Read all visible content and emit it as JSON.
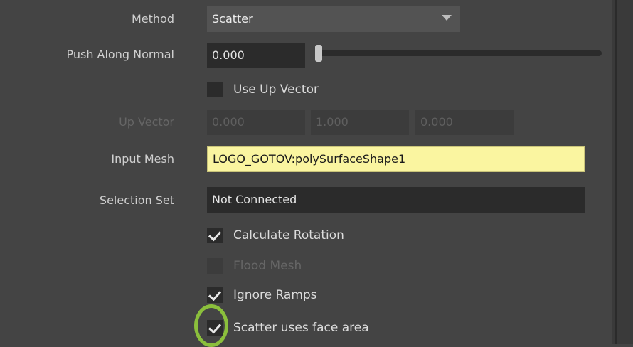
{
  "method": {
    "label": "Method",
    "value": "Scatter"
  },
  "push_along_normal": {
    "label": "Push Along Normal",
    "value": "0.000",
    "slider_fraction": 0.0
  },
  "use_up_vector": {
    "label": "Use Up Vector",
    "checked": false
  },
  "up_vector": {
    "label": "Up Vector",
    "x": "0.000",
    "y": "1.000",
    "z": "0.000"
  },
  "input_mesh": {
    "label": "Input Mesh",
    "value": "LOGO_GOTOV:polySurfaceShape1"
  },
  "selection_set": {
    "label": "Selection Set",
    "value": "Not Connected"
  },
  "calculate_rotation": {
    "label": "Calculate Rotation",
    "checked": true
  },
  "flood_mesh": {
    "label": "Flood Mesh",
    "checked": false
  },
  "ignore_ramps": {
    "label": "Ignore Ramps",
    "checked": true
  },
  "scatter_uses_face_area": {
    "label": "Scatter uses face area",
    "checked": true
  },
  "colors": {
    "highlight_field": "#faf5a0",
    "highlight_ring": "#8bbf3c",
    "panel_bg": "#444444"
  }
}
